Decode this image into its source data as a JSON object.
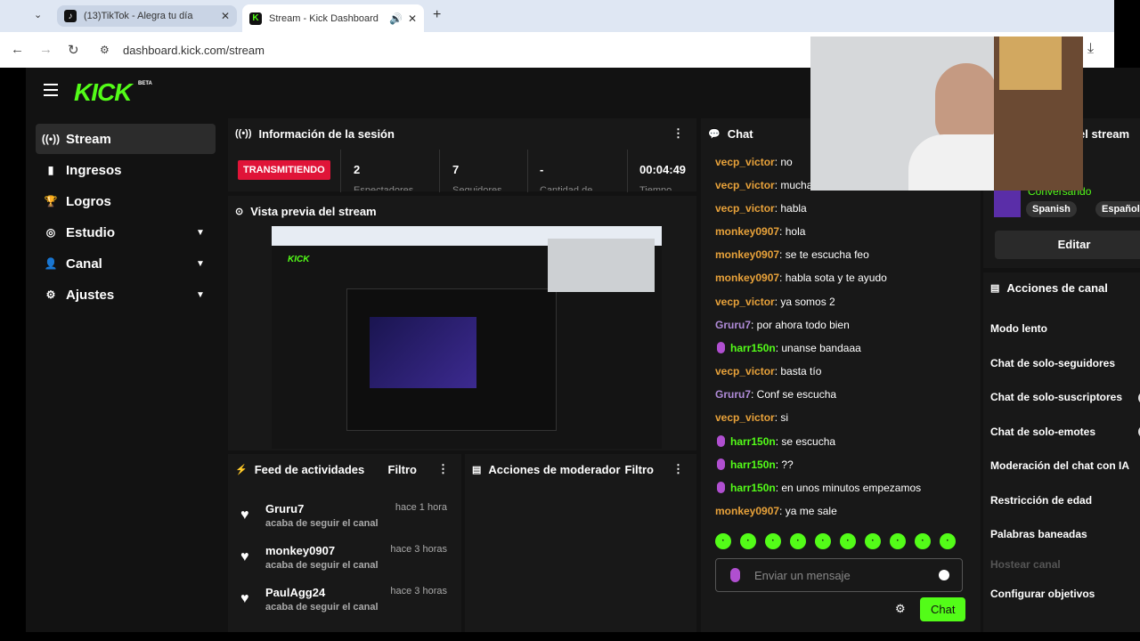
{
  "browser": {
    "tabs": [
      {
        "title": "(13)TikTok - Alegra tu día"
      },
      {
        "title": "Stream - Kick Dashboard"
      }
    ],
    "url": "dashboard.kick.com/stream"
  },
  "app": {
    "logo": "KICK",
    "beta": "BETA"
  },
  "sidebar": {
    "items": [
      {
        "label": "Stream",
        "icon": "broadcast-icon"
      },
      {
        "label": "Ingresos",
        "icon": "chart-icon"
      },
      {
        "label": "Logros",
        "icon": "trophy-icon"
      },
      {
        "label": "Estudio",
        "icon": "camera-icon"
      },
      {
        "label": "Canal",
        "icon": "user-icon"
      },
      {
        "label": "Ajustes",
        "icon": "gear-icon"
      }
    ]
  },
  "session": {
    "title": "Información de la sesión",
    "badge": "TRANSMITIENDO",
    "viewers": "2",
    "viewers_label": "Espectadores",
    "followers": "7",
    "followers_label": "Seguidores",
    "amount": "-",
    "amount_label": "Cantidad de",
    "time": "00:04:49",
    "time_label": "Tiempo"
  },
  "preview": {
    "title": "Vista previa del stream"
  },
  "feed": {
    "title": "Feed de actividades",
    "filter": "Filtro",
    "items": [
      {
        "user": "Gruru7",
        "desc": "acaba de seguir el canal",
        "time": "hace 1 hora"
      },
      {
        "user": "monkey0907",
        "desc": "acaba de seguir el canal",
        "time": "hace 3 horas"
      },
      {
        "user": "PaulAgg24",
        "desc": "acaba de seguir el canal",
        "time": "hace 3 horas"
      }
    ]
  },
  "modactions": {
    "title": "Acciones de moderador",
    "filter": "Filtro"
  },
  "chat": {
    "title": "Chat",
    "messages": [
      {
        "user": "vecp_victor",
        "text": ": no",
        "color": "orange"
      },
      {
        "user": "vecp_victor",
        "text": ": mucha",
        "color": "orange"
      },
      {
        "user": "vecp_victor",
        "text": ": habla",
        "color": "orange"
      },
      {
        "user": "monkey0907",
        "text": ": hola",
        "color": "orange"
      },
      {
        "user": "monkey0907",
        "text": ": se te escucha feo",
        "color": "orange"
      },
      {
        "user": "monkey0907",
        "text": ": habla sota y te ayudo",
        "color": "orange"
      },
      {
        "user": "vecp_victor",
        "text": ": ya somos 2",
        "color": "orange"
      },
      {
        "user": "Gruru7",
        "text": ": por ahora todo bien",
        "color": "purple"
      },
      {
        "user": "harr150n",
        "text": ": unanse bandaaa",
        "color": "green"
      },
      {
        "user": "vecp_victor",
        "text": ": basta tío",
        "color": "orange"
      },
      {
        "user": "Gruru7",
        "text": ": Conf se escucha",
        "color": "purple"
      },
      {
        "user": "vecp_victor",
        "text": ": si",
        "color": "orange"
      },
      {
        "user": "harr150n",
        "text": ": se escucha",
        "color": "green"
      },
      {
        "user": "harr150n",
        "text": ": ??",
        "color": "green"
      },
      {
        "user": "harr150n",
        "text": ": en unos minutos empezamos",
        "color": "green"
      },
      {
        "user": "monkey0907",
        "text": ": ya me sale",
        "color": "orange"
      }
    ],
    "input_placeholder": "Enviar un mensaje",
    "send_label": "Chat"
  },
  "streaminfo": {
    "title_suffix": "el stream",
    "category": "Conversando",
    "tag1": "Spanish",
    "tag2": "Español",
    "edit": "Editar"
  },
  "channel_actions": {
    "title": "Acciones de canal",
    "items": [
      {
        "label": "Modo lento"
      },
      {
        "label": "Chat de solo-seguidores"
      },
      {
        "label": "Chat de solo-suscriptores"
      },
      {
        "label": "Chat de solo-emotes"
      },
      {
        "label": "Moderación del chat con IA"
      },
      {
        "label": "Restricción de edad"
      },
      {
        "label": "Palabras baneadas"
      },
      {
        "label": "Hostear canal"
      },
      {
        "label": "Configurar objetivos"
      }
    ]
  },
  "colors": {
    "accent": "#53fc18",
    "live": "#e01438",
    "bg": "#121212"
  }
}
